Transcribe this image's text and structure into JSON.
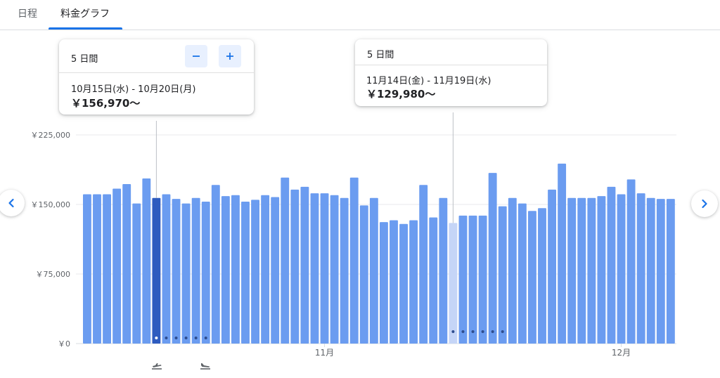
{
  "tabs": [
    {
      "label": "日程"
    },
    {
      "label": "料金グラフ"
    }
  ],
  "cards": [
    {
      "duration": "5 日間",
      "dates": "10月15日(水) - 10月20日(月)",
      "price": "￥156,970〜"
    },
    {
      "duration": "5 日間",
      "dates": "11月14日(金) - 11月19日(水)",
      "price": "￥129,980〜"
    }
  ],
  "icons": {
    "prev": "chevron-left-icon",
    "next": "chevron-right-icon",
    "minus": "minus-icon",
    "plus": "plus-icon",
    "departure": "flight-takeoff-icon",
    "arrival": "flight-land-icon"
  },
  "colors": {
    "bar": "#6b9cf0",
    "bar_selected": "#2e5bbf",
    "bar_highlight": "#c5d5f7",
    "accent": "#1a73e8",
    "grid": "#e8eaed",
    "marker_dot": "#2e4d8f"
  },
  "chart_data": {
    "type": "bar",
    "yticks": [
      "￥0",
      "￥75,000",
      "￥150,000",
      "￥225,000"
    ],
    "ytick_values": [
      0,
      75000,
      150000,
      225000
    ],
    "ylim": [
      0,
      225000
    ],
    "xtick_labels": [
      {
        "label": "11月",
        "index": 24
      },
      {
        "label": "12月",
        "index": 54
      }
    ],
    "values": [
      161000,
      161000,
      161000,
      167000,
      172000,
      151000,
      178000,
      156970,
      161000,
      156000,
      151000,
      157000,
      153000,
      171000,
      159000,
      160000,
      153000,
      155000,
      160000,
      158000,
      179000,
      166000,
      169000,
      162000,
      162000,
      160000,
      157000,
      179000,
      149000,
      157000,
      131000,
      133000,
      129000,
      133000,
      171000,
      136000,
      157000,
      129980,
      138000,
      138000,
      138000,
      184000,
      148000,
      157000,
      151000,
      143000,
      146000,
      166000,
      194000,
      157000,
      157000,
      157000,
      159000,
      169000,
      161000,
      177000,
      162000,
      157000,
      156000,
      156000
    ],
    "selected_index": 7,
    "highlight_index": 37
  }
}
